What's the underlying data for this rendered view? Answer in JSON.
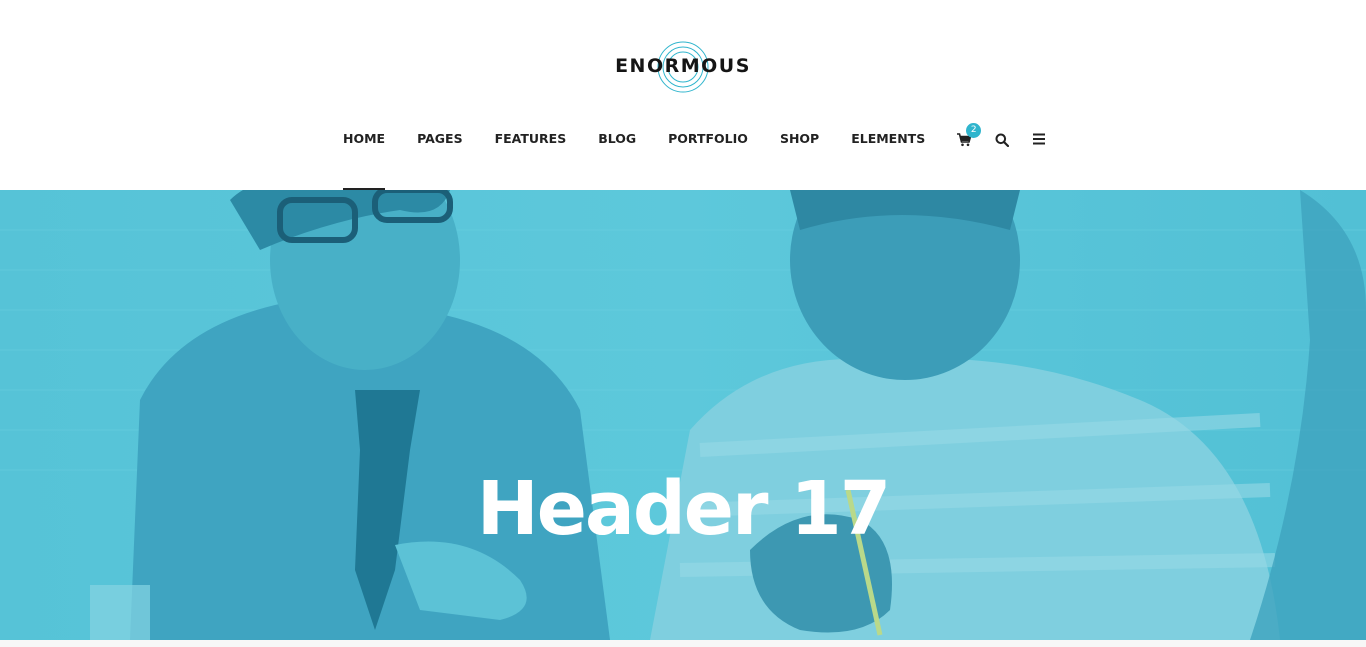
{
  "brand": {
    "name": "ENORMOUS",
    "logo_icon": "concentric-circles-logo",
    "accent_color": "#30b5cd"
  },
  "nav": {
    "items": [
      {
        "label": "HOME",
        "active": true
      },
      {
        "label": "PAGES"
      },
      {
        "label": "FEATURES"
      },
      {
        "label": "BLOG"
      },
      {
        "label": "PORTFOLIO"
      },
      {
        "label": "SHOP"
      },
      {
        "label": "ELEMENTS"
      }
    ],
    "cart": {
      "icon": "cart-icon",
      "count": "2"
    },
    "search": {
      "icon": "search-icon"
    },
    "menu": {
      "icon": "hamburger-menu-icon"
    }
  },
  "hero": {
    "title": "Header 17",
    "overlay_color": "#4fbfd4"
  }
}
